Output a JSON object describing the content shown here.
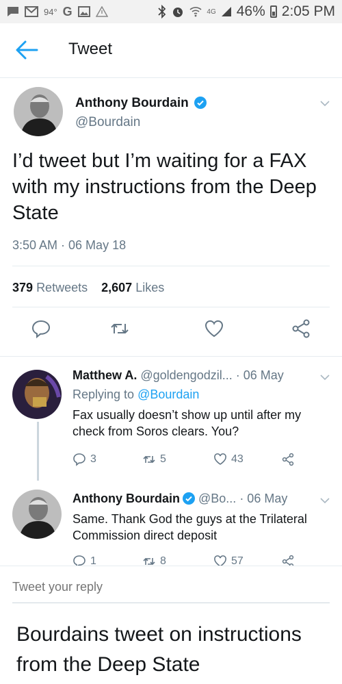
{
  "status_bar": {
    "temperature": "94°",
    "google_letter": "G",
    "network": "4G",
    "battery_percent": "46%",
    "time": "2:05 PM"
  },
  "header": {
    "title": "Tweet"
  },
  "main_tweet": {
    "author_name": "Anthony Bourdain",
    "author_handle": "@Bourdain",
    "text": "I’d tweet but I’m waiting for a FAX with my instructions from the Deep State",
    "timestamp": "3:50 AM · 06 May 18",
    "retweets_count": "379",
    "retweets_label": "Retweets",
    "likes_count": "2,607",
    "likes_label": "Likes"
  },
  "replies": [
    {
      "author_name": "Matthew A.",
      "author_handle": "@goldengodzil...",
      "date": "· 06 May",
      "replying_prefix": "Replying to ",
      "replying_to": "@Bourdain",
      "text": "Fax usually doesn’t show up until after my check from Soros clears. You?",
      "replies_count": "3",
      "retweets_count": "5",
      "likes_count": "43"
    },
    {
      "author_name": "Anthony Bourdain",
      "author_handle": "@Bo...",
      "date": "· 06 May",
      "text": "Same. Thank God the guys at the Trilateral Commission direct deposit",
      "replies_count": "1",
      "retweets_count": "8",
      "likes_count": "57"
    }
  ],
  "composer": {
    "placeholder": "Tweet your reply"
  },
  "caption": "Bourdains tweet on instructions from the Deep State",
  "colors": {
    "accent": "#1da1f2",
    "secondary_text": "#657786",
    "divider": "#e6ecf0"
  }
}
